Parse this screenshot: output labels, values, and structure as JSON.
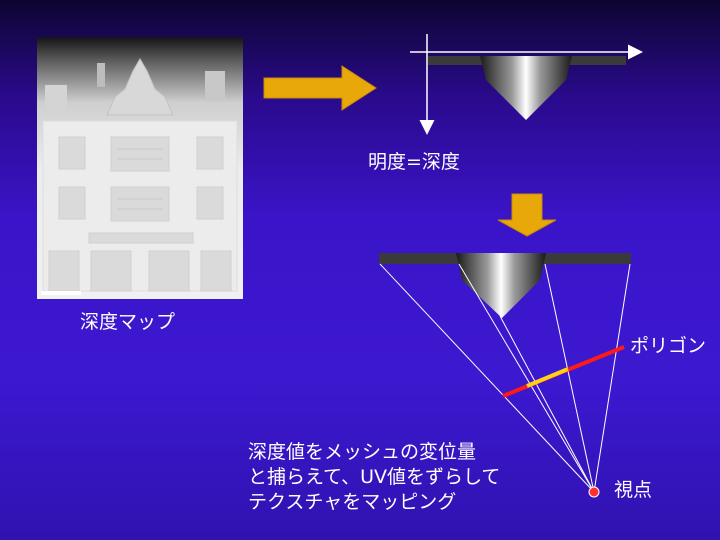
{
  "labels": {
    "depth_map": "深度マップ",
    "brightness_depth": "明度=深度",
    "polygon": "ポリゴン",
    "viewpoint": "視点"
  },
  "body_lines": [
    "深度値をメッシュの変位量",
    "と捕らえて、UV値をずらして",
    "テクスチャをマッピング"
  ],
  "colors": {
    "arrow": "#e8a80a",
    "polygon_line": "#ff1a1a",
    "polygon_highlight": "#ffd21a",
    "viewpoint_dot": "#ff3030",
    "bar": "#3a3a3a"
  }
}
